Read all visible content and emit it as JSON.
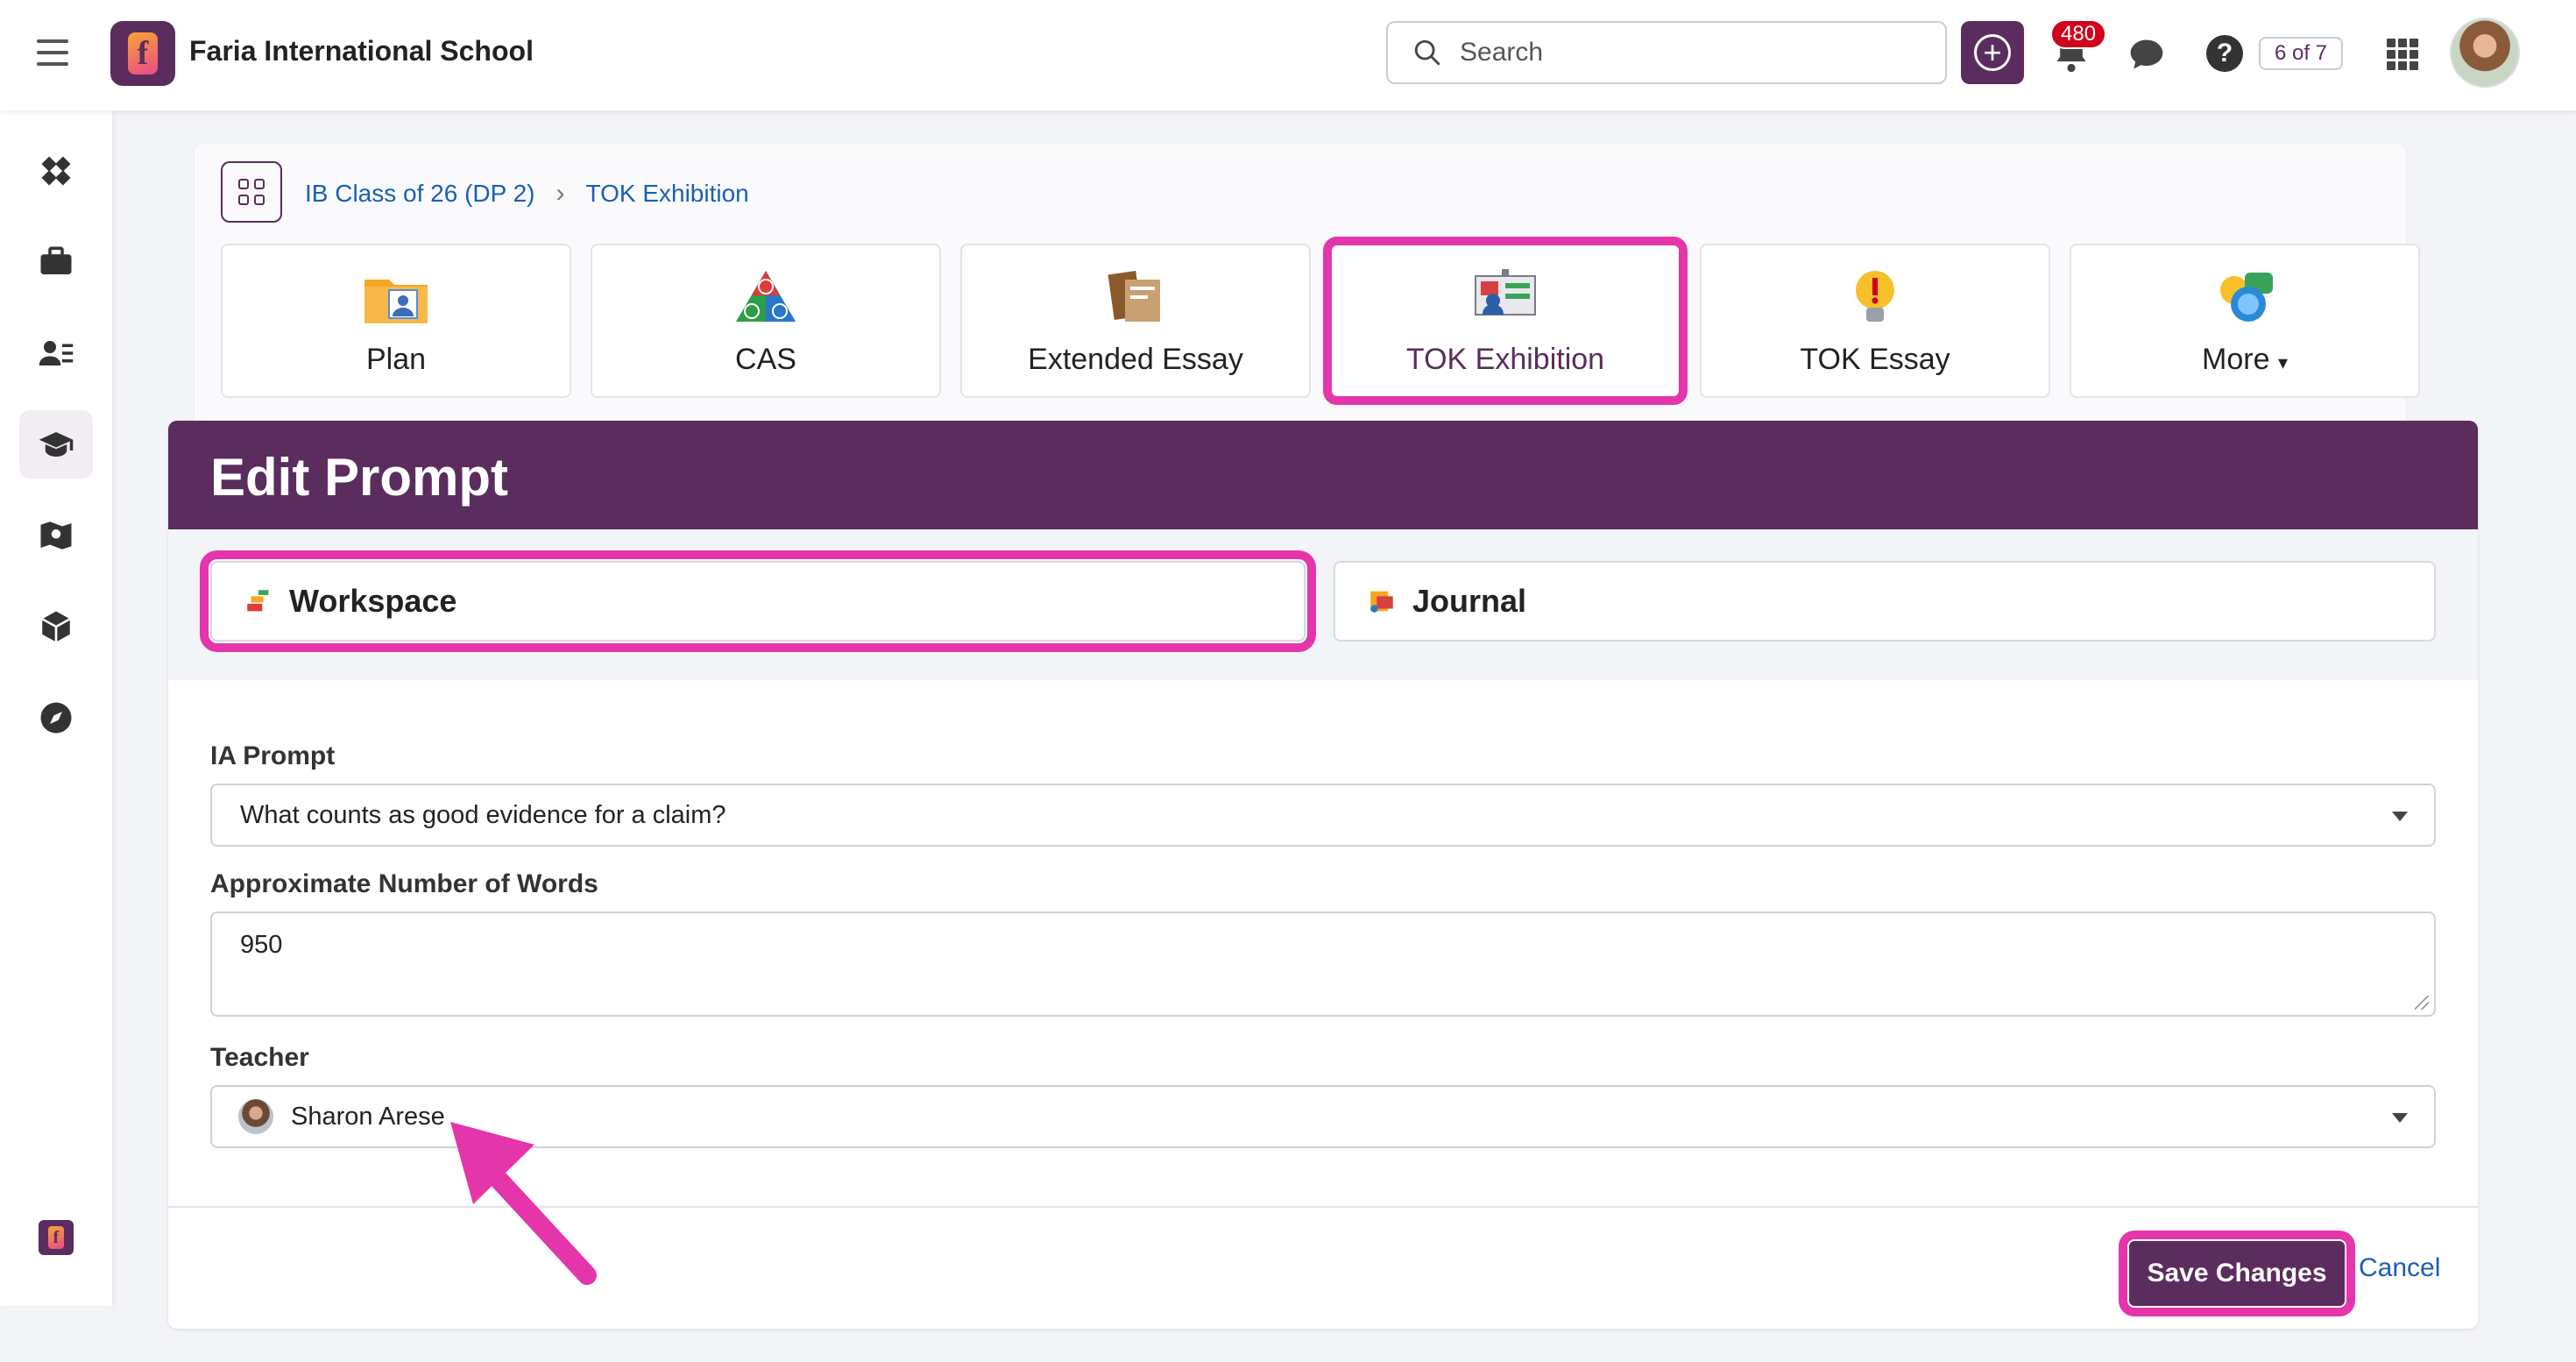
{
  "header": {
    "school_name": "Faria International School",
    "search_placeholder": "Search",
    "notification_count": "480",
    "steps": "6 of 7"
  },
  "sidebar": {
    "items": [
      "diamond-icon",
      "briefcase-icon",
      "people-icon",
      "graduation-cap-icon",
      "map-icon",
      "cube-icon",
      "compass-icon"
    ],
    "active_index": 3
  },
  "breadcrumb": {
    "items": [
      "IB Class of 26 (DP 2)",
      "TOK Exhibition"
    ]
  },
  "nav_tiles": [
    {
      "label": "Plan",
      "icon": "folder-person-icon"
    },
    {
      "label": "CAS",
      "icon": "cas-triangle-icon"
    },
    {
      "label": "Extended Essay",
      "icon": "books-icon"
    },
    {
      "label": "TOK Exhibition",
      "icon": "presentation-icon"
    },
    {
      "label": "TOK Essay",
      "icon": "lightbulb-icon"
    },
    {
      "label": "More",
      "icon": "chat-bubbles-icon"
    }
  ],
  "edit_prompt": {
    "title": "Edit Prompt",
    "tabs": [
      {
        "label": "Workspace",
        "icon": "workspace-icon"
      },
      {
        "label": "Journal",
        "icon": "journal-icon"
      }
    ],
    "ia_prompt_label": "IA Prompt",
    "ia_prompt_value": "What counts as good evidence for a claim?",
    "words_label": "Approximate Number of Words",
    "words_value": "950",
    "teacher_label": "Teacher",
    "teacher_value": "Sharon Arese",
    "save_label": "Save Changes",
    "cancel_label": "Cancel"
  },
  "colors": {
    "brand": "#5a2d5e",
    "highlight": "#e535ab",
    "link": "#1a5fb4",
    "badge": "#d0021b"
  }
}
